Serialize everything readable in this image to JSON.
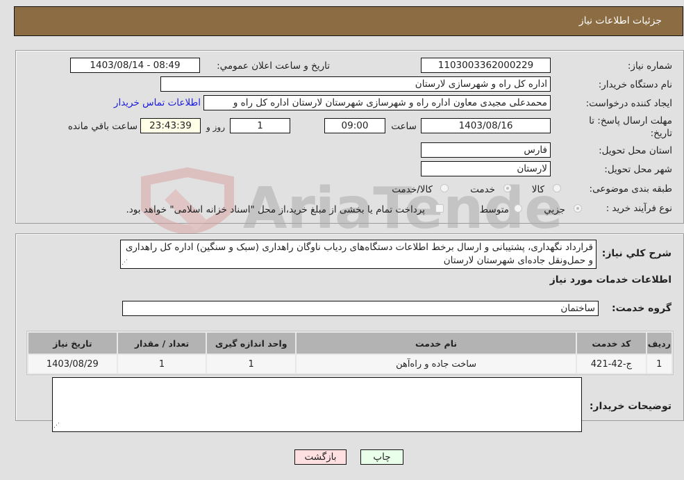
{
  "header": {
    "title": "جزئیات اطلاعات نیاز"
  },
  "form": {
    "need_number": {
      "label": "شماره نیاز:",
      "value": "1103003362000229"
    },
    "announce_datetime": {
      "label": "تاریخ و ساعت اعلان عمومي:",
      "value": "1403/08/14 - 08:49"
    },
    "buyer_org": {
      "label": "نام دستگاه خريدار:",
      "value": "اداره کل راه و شهرسازی لارستان"
    },
    "requester": {
      "label": "ایجاد کننده درخواست:",
      "value": "محمدعلی مجیدی معاون اداره راه و شهرسازی شهرستان لارستان اداره کل راه و"
    },
    "buyer_contact_link": "اطلاعات تماس خريدار",
    "deadline": {
      "label": "مهلت ارسال پاسخ: تا تاریخ:",
      "date": "1403/08/16",
      "time_label": "ساعت",
      "time": "09:00",
      "days": "1",
      "days_label": "روز و",
      "remaining": "23:43:39",
      "remaining_label": "ساعت باقي مانده"
    },
    "province": {
      "label": "استان محل تحویل:",
      "value": "فارس"
    },
    "city": {
      "label": "شهر محل تحویل:",
      "value": "لارستان"
    },
    "category": {
      "label": "طبقه بندی موضوعی:",
      "options": [
        "کالا",
        "خدمت",
        "کالا/خدمت"
      ],
      "selected": "خدمت"
    },
    "purchase_type": {
      "label": "نوع فرآیند خرید :",
      "options": [
        "جزيي",
        "متوسط"
      ],
      "selected": "جزيي",
      "treasury_note": "پرداخت تمام یا بخشی از مبلغ خرید،از محل \"اسناد خزانه اسلامی\" خواهد بود."
    }
  },
  "details": {
    "summary_label": "شرح کلي نياز:",
    "summary_text": "قرارداد نگهداری، پشتیبانی و ارسال برخط اطلاعات دستگاه‌های ردیاب ناوگان راهداری (سبک و سنگین) اداره کل راهداری و حمل‌ونقل جاده‌ای شهرستان لارستان",
    "services_heading": "اطلاعات خدمات مورد نياز",
    "service_group_label": "گروه خدمت:",
    "service_group_value": "ساختمان",
    "table": {
      "headers": [
        "رديف",
        "کد خدمت",
        "نام خدمت",
        "واحد اندازه گیری",
        "تعداد / مقدار",
        "تاریخ نیاز"
      ],
      "rows": [
        [
          "1",
          "ج-42-421",
          "ساخت جاده و راه‌آهن",
          "1",
          "1",
          "1403/08/29"
        ]
      ]
    },
    "buyer_notes_label": "توضیحات خریدار:",
    "buyer_notes_value": ""
  },
  "buttons": {
    "print": "چاپ",
    "back": "بازگشت"
  },
  "watermark": {
    "text": "AriaTender.neT"
  },
  "colors": {
    "header_bg": "#8c6c43",
    "print_bg": "#eaffea",
    "back_bg": "#ffe0e0",
    "link": "#1a1adc",
    "remaining_bg": "#ffffe8"
  }
}
